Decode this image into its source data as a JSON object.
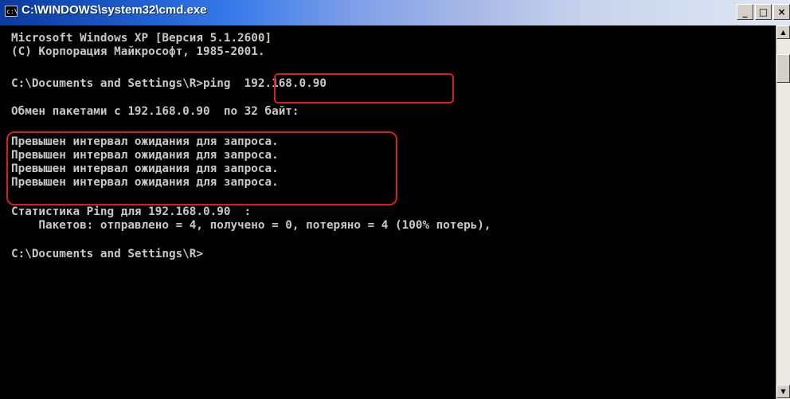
{
  "window": {
    "title": "C:\\WINDOWS\\system32\\cmd.exe",
    "icon": "cmd-icon",
    "icon_label": "c:\\",
    "controls": {
      "minimize": "_",
      "maximize": "□",
      "close": "×"
    }
  },
  "console": {
    "lines": [
      "Microsoft Windows XP [Версия 5.1.2600]",
      "(С) Корпорация Майкрософт, 1985-2001.",
      "",
      "C:\\Documents and Settings\\R>ping  192.168.0.90",
      "",
      "Обмен пакетами с 192.168.0.90  по 32 байт:",
      "",
      "Превышен интервал ожидания для запроса.",
      "Превышен интервал ожидания для запроса.",
      "Превышен интервал ожидания для запроса.",
      "Превышен интервал ожидания для запроса.",
      "",
      "Статистика Ping для 192.168.0.90  :",
      "    Пакетов: отправлено = 4, получено = 0, потеряно = 4 (100% потерь),",
      "",
      "C:\\Documents and Settings\\R>"
    ]
  },
  "colors": {
    "console_background": "#000000",
    "console_text": "#c8c8c8",
    "highlight": "#d42020",
    "titlebar_start": "#0a3a9c",
    "titlebar_end": "#dfe7f4"
  },
  "scrollbar": {
    "up_icon": "▲",
    "down_icon": "▼"
  }
}
